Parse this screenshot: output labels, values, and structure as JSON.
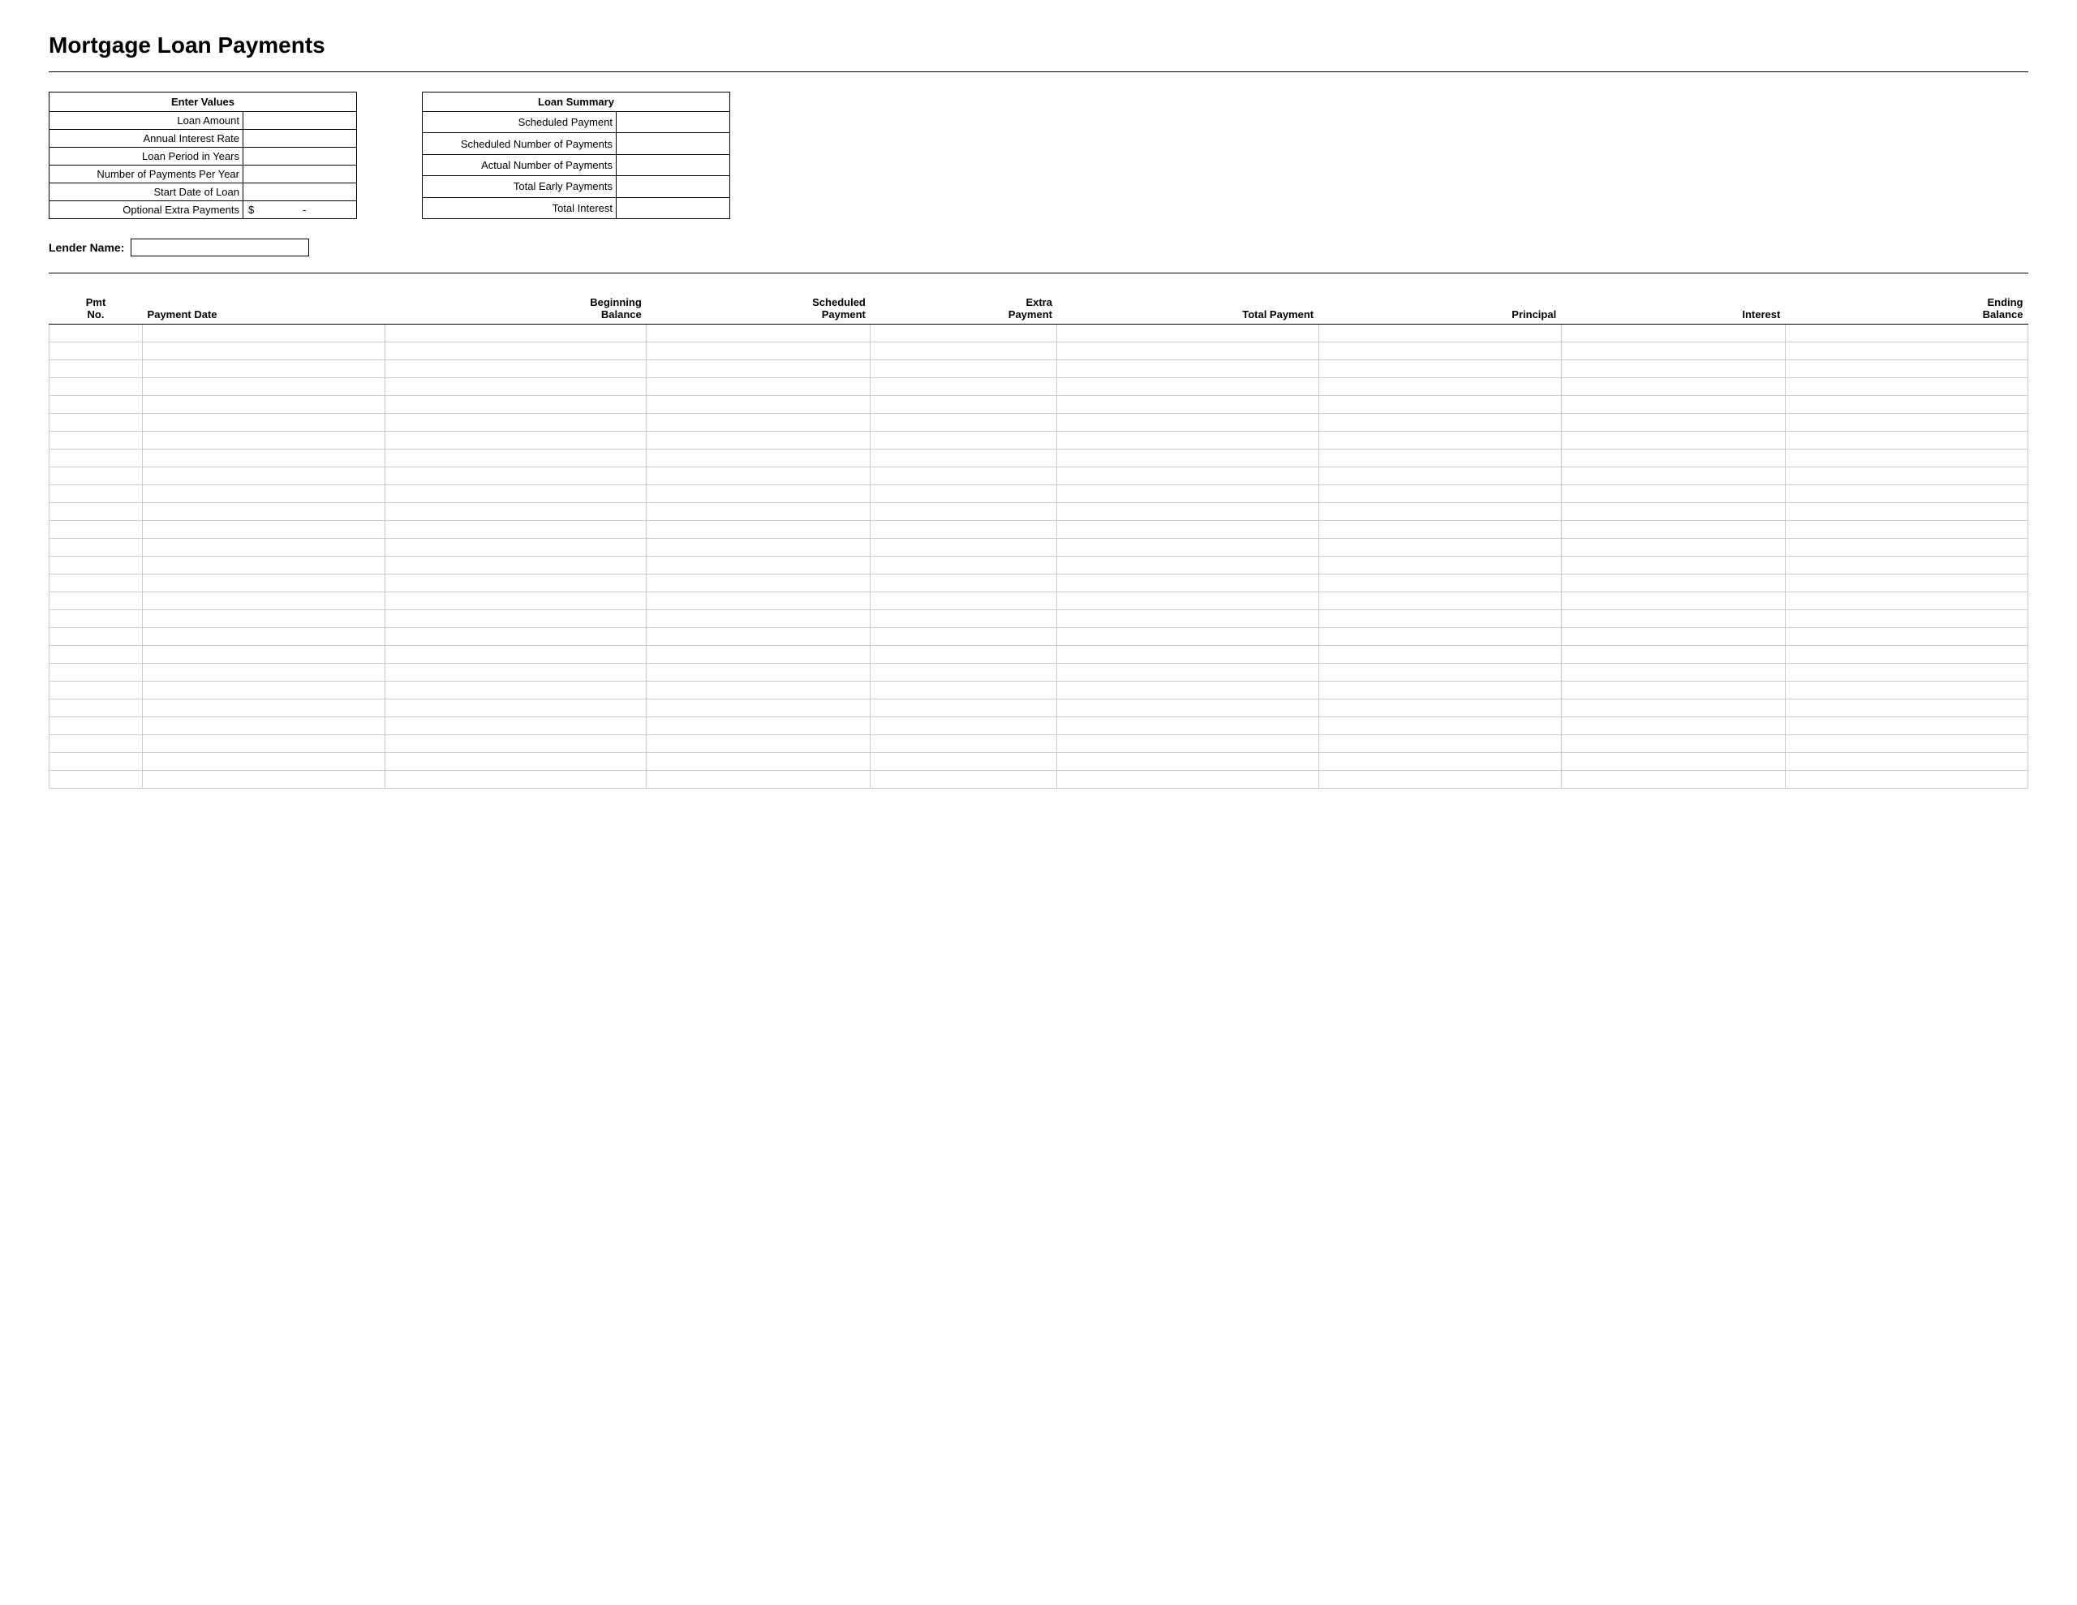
{
  "page": {
    "title": "Mortgage Loan Payments"
  },
  "enter_values": {
    "header": "Enter Values",
    "fields": [
      {
        "label": "Loan Amount",
        "value": ""
      },
      {
        "label": "Annual Interest Rate",
        "value": ""
      },
      {
        "label": "Loan Period in Years",
        "value": ""
      },
      {
        "label": "Number of Payments Per Year",
        "value": ""
      },
      {
        "label": "Start Date of Loan",
        "value": ""
      },
      {
        "label": "Optional Extra Payments",
        "prefix": "$",
        "value": "-"
      }
    ]
  },
  "loan_summary": {
    "header": "Loan Summary",
    "fields": [
      {
        "label": "Scheduled Payment",
        "value": ""
      },
      {
        "label": "Scheduled Number of Payments",
        "value": ""
      },
      {
        "label": "Actual Number of Payments",
        "value": ""
      },
      {
        "label": "Total Early Payments",
        "value": ""
      },
      {
        "label": "Total Interest",
        "value": ""
      }
    ]
  },
  "lender": {
    "label": "Lender Name:",
    "placeholder": ""
  },
  "table": {
    "headers": [
      {
        "line1": "Pmt",
        "line2": "No."
      },
      {
        "line1": "",
        "line2": "Payment Date"
      },
      {
        "line1": "Beginning",
        "line2": "Balance"
      },
      {
        "line1": "Scheduled",
        "line2": "Payment"
      },
      {
        "line1": "Extra",
        "line2": "Payment"
      },
      {
        "line1": "",
        "line2": "Total Payment"
      },
      {
        "line1": "",
        "line2": "Principal"
      },
      {
        "line1": "",
        "line2": "Interest"
      },
      {
        "line1": "Ending",
        "line2": "Balance"
      }
    ],
    "row_count": 26
  }
}
